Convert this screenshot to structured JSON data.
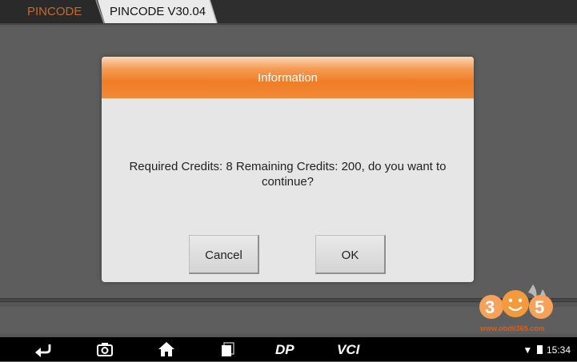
{
  "breadcrumb": {
    "items": [
      {
        "label": "PINCODE"
      },
      {
        "label": "PINCODE V30.04"
      }
    ]
  },
  "dialog": {
    "title": "Information",
    "message": "Required Credits: 8 Remaining Credits: 200, do you want to continue?",
    "cancel_label": "Cancel",
    "ok_label": "OK"
  },
  "navbar": {
    "icons": [
      "back-icon",
      "screenshot-icon",
      "home-icon",
      "recent-apps-icon",
      "dp-icon",
      "vci-icon"
    ],
    "dp_label": "DP",
    "vci_label": "VCI"
  },
  "status_bar": {
    "time": "15:34"
  },
  "watermark": {
    "logo_digits": "365",
    "url": "www.obdii365.com"
  },
  "colors": {
    "accent": "#f07d25",
    "crumb_inactive": "#c8692c",
    "dialog_bg": "#e6e6e6"
  }
}
